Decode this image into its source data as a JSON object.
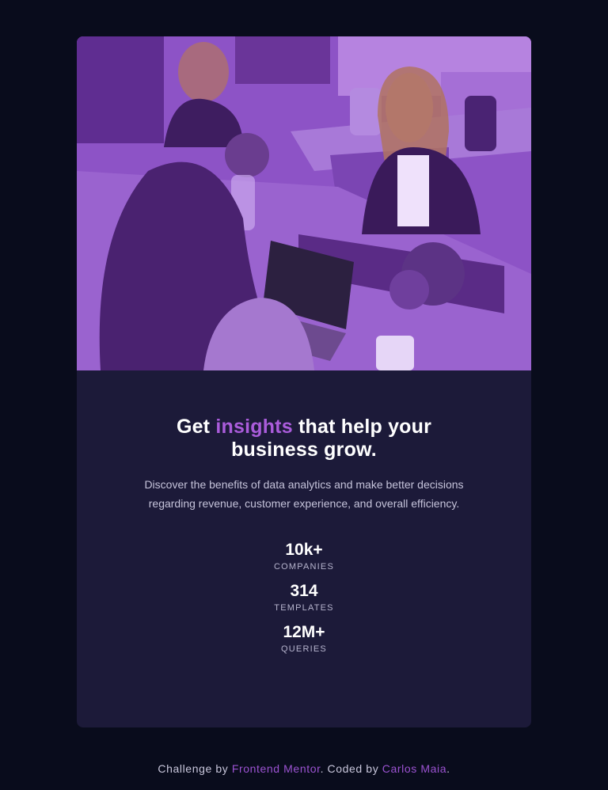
{
  "card": {
    "title_before": "Get",
    "title_accent": "insights",
    "title_after": "that help your business grow.",
    "description": "Discover the benefits of data analytics and make better decisions regarding revenue, customer experience, and overall efficiency."
  },
  "stats": [
    {
      "value": "10k+",
      "label": "COMPANIES"
    },
    {
      "value": "314",
      "label": "TEMPLATES"
    },
    {
      "value": "12M+",
      "label": "QUERIES"
    }
  ],
  "footer": {
    "prefix": "Challenge by",
    "link1": "Frontend Mentor",
    "middle": ". Coded by",
    "link2": "Carlos Maia",
    "suffix": "."
  },
  "colors": {
    "page_bg": "#090c1c",
    "card_bg": "#1c1a39",
    "accent": "#aa5cdb",
    "image_tint": "#8a4fc7"
  },
  "icons": {
    "hero": "office-team-photo"
  }
}
